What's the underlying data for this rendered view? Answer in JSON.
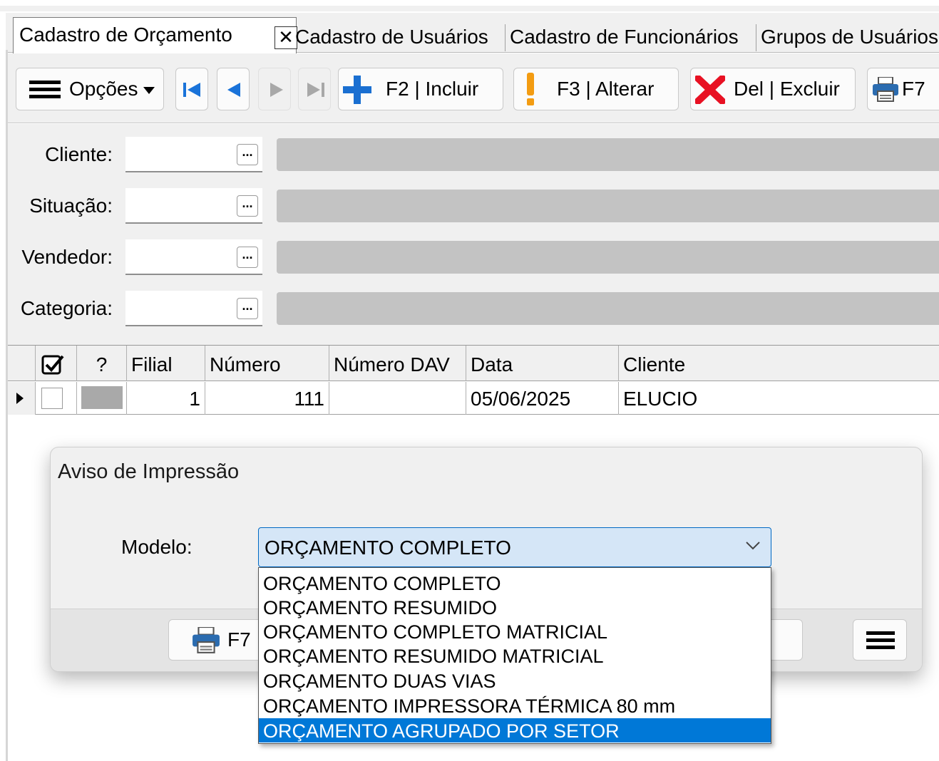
{
  "tabs": [
    {
      "label": "Cadastro de Orçamento",
      "active": true
    },
    {
      "label": "Cadastro de Usuários",
      "active": false
    },
    {
      "label": "Cadastro de Funcionários",
      "active": false
    },
    {
      "label": "Grupos de Usuários",
      "active": false
    }
  ],
  "toolbar": {
    "options_label": "Opções",
    "include_label": "F2 | Incluir",
    "alter_label": "F3 | Alterar",
    "delete_label": "Del | Excluir",
    "print_label": "F7"
  },
  "filters": {
    "cliente_label": "Cliente:",
    "situacao_label": "Situação:",
    "vendedor_label": "Vendedor:",
    "categoria_label": "Categoria:",
    "lookup_button": "..."
  },
  "grid": {
    "columns": [
      "?",
      "Filial",
      "Número",
      "Número DAV",
      "Data",
      "Cliente"
    ],
    "rows": [
      {
        "filial": "1",
        "numero": "111",
        "numero_dav": "",
        "data": "05/06/2025",
        "cliente": "ELUCIO"
      }
    ]
  },
  "dialog": {
    "title": "Aviso de Impressão",
    "modelo_label": "Modelo:",
    "modelo_value": "ORÇAMENTO COMPLETO",
    "options": [
      "ORÇAMENTO COMPLETO",
      "ORÇAMENTO RESUMIDO",
      "ORÇAMENTO COMPLETO MATRICIAL",
      "ORÇAMENTO RESUMIDO MATRICIAL",
      "ORÇAMENTO DUAS VIAS",
      "ORÇAMENTO IMPRESSORA TÉRMICA 80 mm",
      "ORÇAMENTO AGRUPADO POR SETOR"
    ],
    "highlighted_option": "ORÇAMENTO AGRUPADO POR SETOR",
    "print_button_label": "F7"
  },
  "colors": {
    "accent": "#0078d7",
    "select_bg": "#d5e6f7",
    "delete_red": "#e81123",
    "plus_blue": "#1a6fd1",
    "warn_orange": "#f39c12"
  }
}
